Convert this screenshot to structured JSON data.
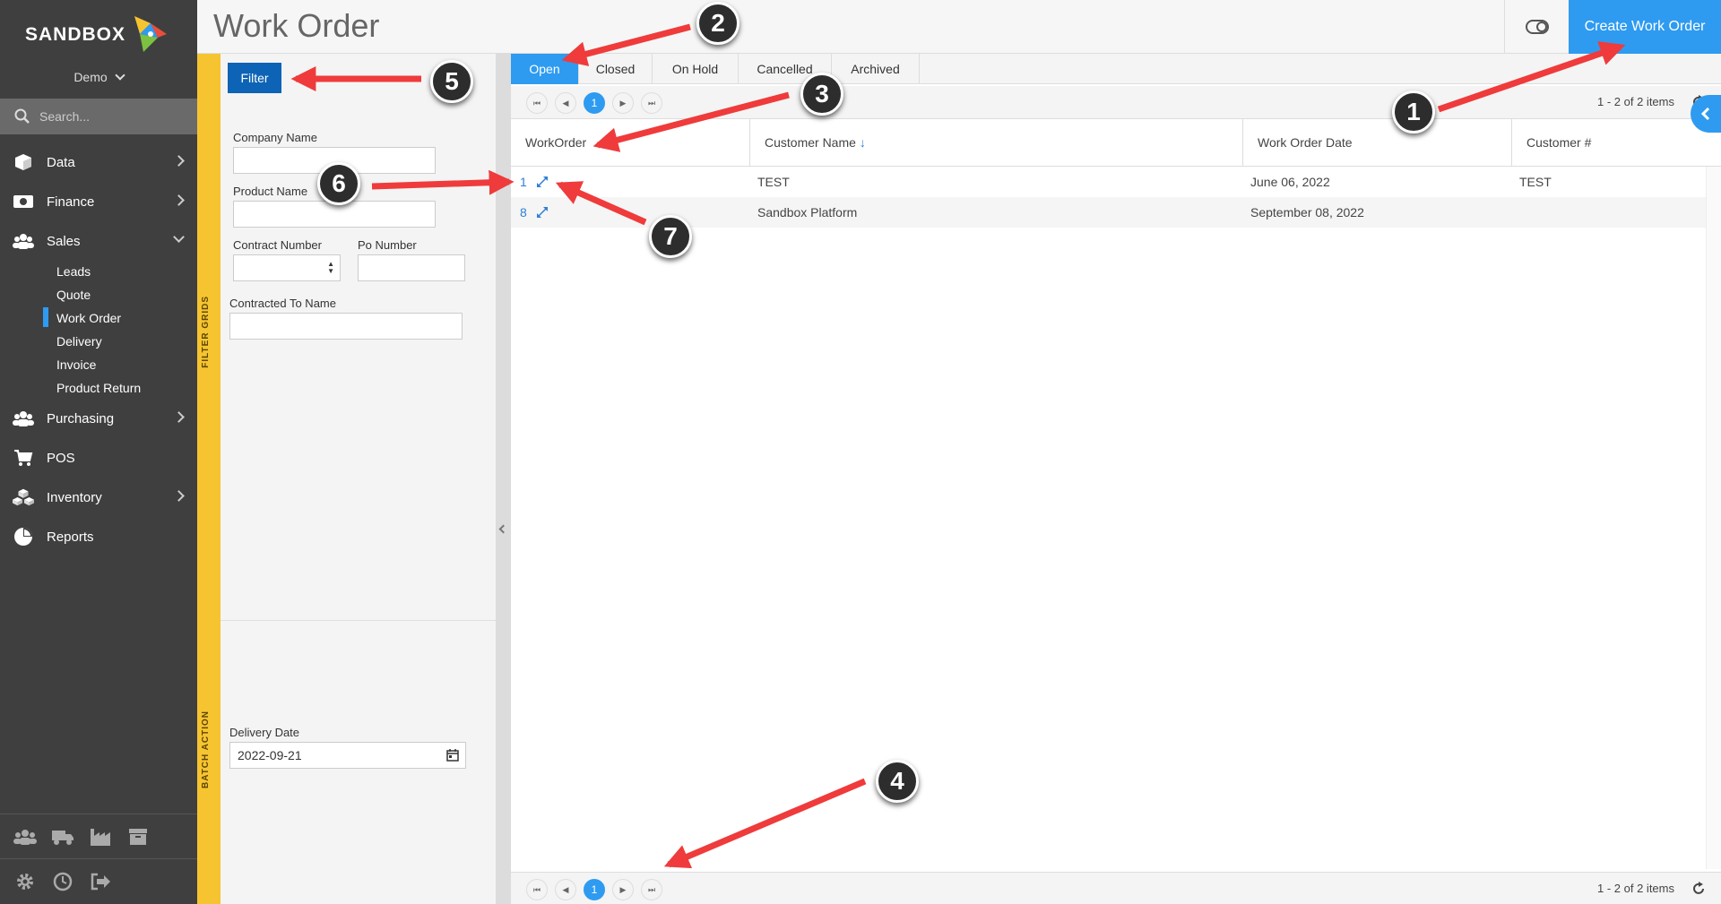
{
  "sidebar": {
    "brand": "SANDBOX",
    "tenant": "Demo",
    "search_placeholder": "Search...",
    "items": [
      {
        "label": "Data",
        "icon": "cube-icon"
      },
      {
        "label": "Finance",
        "icon": "money-icon"
      },
      {
        "label": "Sales",
        "icon": "users-icon",
        "expanded": true
      },
      {
        "label": "Purchasing",
        "icon": "users-icon"
      },
      {
        "label": "POS",
        "icon": "cart-icon"
      },
      {
        "label": "Inventory",
        "icon": "boxes-icon"
      },
      {
        "label": "Reports",
        "icon": "pie-chart-icon"
      }
    ],
    "sales_sub": [
      "Leads",
      "Quote",
      "Work Order",
      "Delivery",
      "Invoice",
      "Product Return"
    ],
    "active_sub": "Work Order"
  },
  "header": {
    "title": "Work Order",
    "create_button": "Create Work Order"
  },
  "filter": {
    "strip_top": "FILTER GRIDS",
    "strip_bottom": "BATCH ACTION",
    "button": "Filter",
    "company_name_label": "Company Name",
    "product_name_label": "Product Name",
    "contract_number_label": "Contract Number",
    "po_number_label": "Po Number",
    "contracted_to_label": "Contracted To Name",
    "delivery_date_label": "Delivery Date",
    "delivery_date_value": "2022-09-21"
  },
  "tabs": [
    "Open",
    "Closed",
    "On Hold",
    "Cancelled",
    "Archived"
  ],
  "active_tab": "Open",
  "pager": {
    "current_page": "1",
    "info": "1 - 2 of 2 items"
  },
  "table": {
    "columns": [
      "WorkOrder",
      "Customer Name",
      "Work Order Date",
      "Customer #"
    ],
    "sort_indicator": "↓",
    "rows": [
      {
        "workorder": "1",
        "customer_name": "TEST",
        "date": "June 06, 2022",
        "customer_no": "TEST"
      },
      {
        "workorder": "8",
        "customer_name": "Sandbox Platform",
        "date": "September 08, 2022",
        "customer_no": ""
      }
    ]
  },
  "annotations": [
    "1",
    "2",
    "3",
    "4",
    "5",
    "6",
    "7"
  ],
  "colors": {
    "accent": "#2e9bf0",
    "filter_button": "#0d63b5",
    "sidebar": "#3f3f3f",
    "strip": "#f7c431",
    "arrow": "#ef3b3b"
  }
}
